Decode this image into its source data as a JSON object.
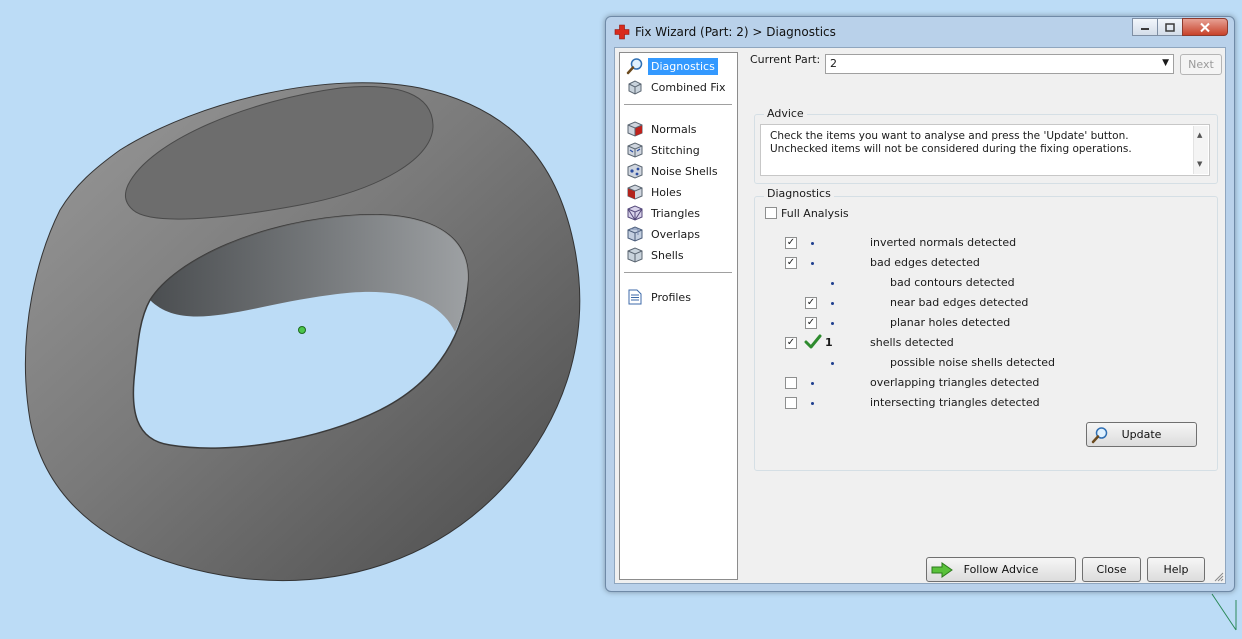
{
  "window": {
    "title": "Fix Wizard (Part: 2) > Diagnostics"
  },
  "nav": {
    "items": [
      {
        "label": "Diagnostics",
        "icon": "magnifier-icon",
        "selected": true
      },
      {
        "label": "Combined Fix",
        "icon": "cube-icon",
        "selected": false
      },
      {
        "label": "Normals",
        "icon": "normals-cube-icon",
        "selected": false
      },
      {
        "label": "Stitching",
        "icon": "stitching-cube-icon",
        "selected": false
      },
      {
        "label": "Noise Shells",
        "icon": "noise-shells-icon",
        "selected": false
      },
      {
        "label": "Holes",
        "icon": "holes-cube-icon",
        "selected": false
      },
      {
        "label": "Triangles",
        "icon": "triangles-cube-icon",
        "selected": false
      },
      {
        "label": "Overlaps",
        "icon": "overlaps-cube-icon",
        "selected": false
      },
      {
        "label": "Shells",
        "icon": "shells-cube-icon",
        "selected": false
      },
      {
        "label": "Profiles",
        "icon": "document-icon",
        "selected": false
      }
    ]
  },
  "current_part": {
    "label": "Current Part:",
    "value": "2",
    "next_label": "Next"
  },
  "advice": {
    "title": "Advice",
    "text": "Check the items you want to analyse and press the 'Update' button. Unchecked items will not be considered during the fixing operations."
  },
  "diagnostics": {
    "title": "Diagnostics",
    "full_analysis_label": "Full Analysis",
    "full_analysis_checked": false,
    "rows": [
      {
        "label": "inverted normals detected",
        "checked": true,
        "indent": 0,
        "has_checkbox": true,
        "count": "",
        "ok": false
      },
      {
        "label": "bad edges detected",
        "checked": true,
        "indent": 0,
        "has_checkbox": true,
        "count": "",
        "ok": false
      },
      {
        "label": "bad contours detected",
        "checked": false,
        "indent": 1,
        "has_checkbox": false,
        "count": "",
        "ok": false
      },
      {
        "label": "near bad edges detected",
        "checked": true,
        "indent": 1,
        "has_checkbox": true,
        "count": "",
        "ok": false
      },
      {
        "label": "planar holes detected",
        "checked": true,
        "indent": 1,
        "has_checkbox": true,
        "count": "",
        "ok": false
      },
      {
        "label": "shells detected",
        "checked": true,
        "indent": 0,
        "has_checkbox": true,
        "count": "1",
        "ok": true
      },
      {
        "label": "possible noise shells detected",
        "checked": false,
        "indent": 1,
        "has_checkbox": false,
        "count": "",
        "ok": false
      },
      {
        "label": "overlapping triangles detected",
        "checked": false,
        "indent": 0,
        "has_checkbox": true,
        "count": "",
        "ok": false
      },
      {
        "label": "intersecting triangles detected",
        "checked": false,
        "indent": 0,
        "has_checkbox": true,
        "count": "",
        "ok": false
      }
    ],
    "update_label": "Update"
  },
  "footer": {
    "follow_advice_label": "Follow Advice",
    "close_label": "Close",
    "help_label": "Help"
  },
  "colors": {
    "background": "#bcdcf6",
    "selection": "#3399ff",
    "ok_check": "#2e8b2e"
  }
}
